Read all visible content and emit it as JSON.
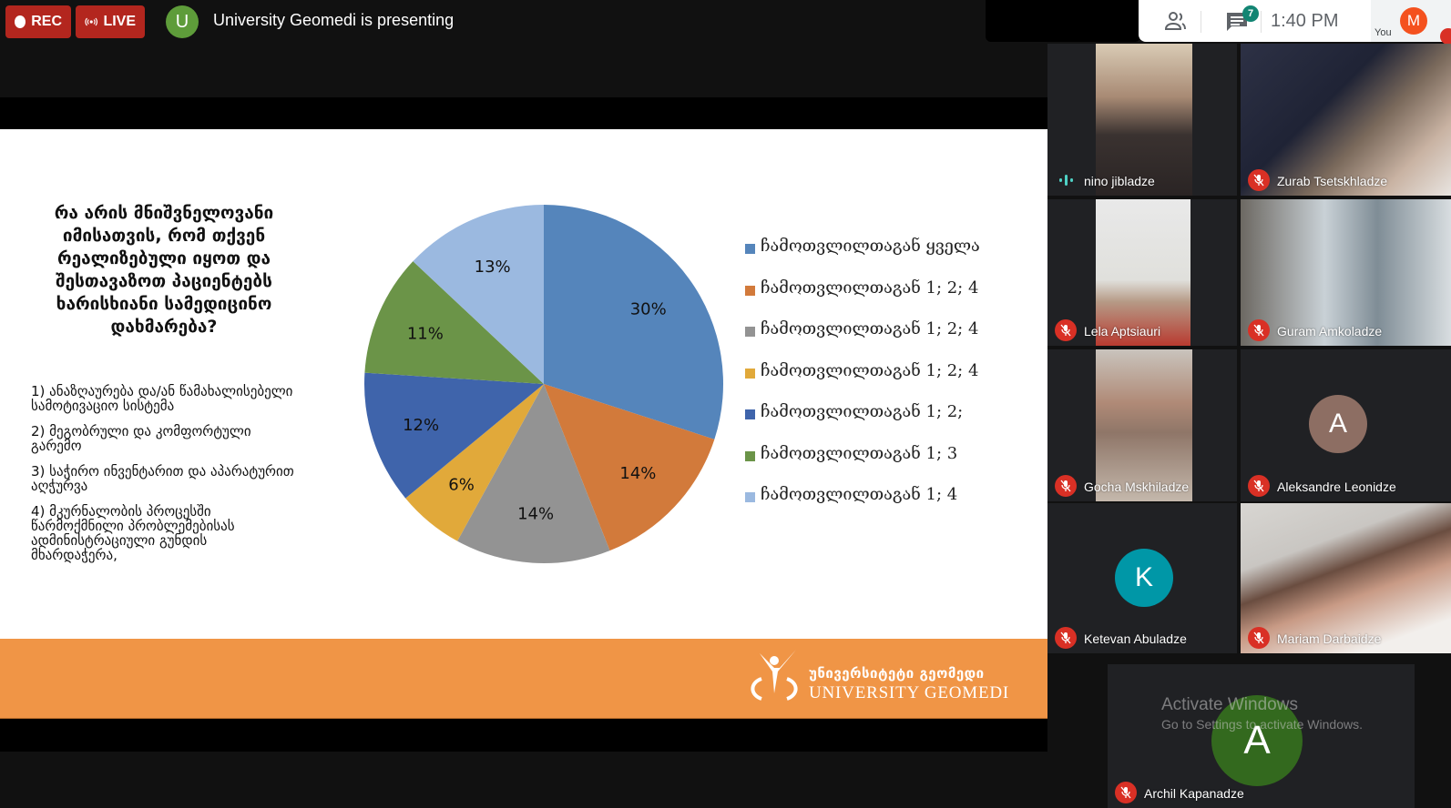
{
  "meeting": {
    "rec_label": "REC",
    "live_label": "LIVE",
    "presenter_initial": "U",
    "presenter_text": "University Geomedi is presenting",
    "chat_count": "7",
    "time": "1:40 PM",
    "you_label": "You",
    "you_initial": "M"
  },
  "slide": {
    "question": "რა არის მნიშვნელოვანი იმისათვის, რომ თქვენ რეალიზებული იყოთ და შესთავაზოთ პაციენტებს ხარისხიანი სამედიცინო დახმარება?",
    "options": [
      "1) ანაზღაურება და/ან წამახალისებელი სამოტივაციო სისტემა",
      "2) მეგობრული და კომფორტული გარემო",
      "3) საჭირო ინვენტარით და აპარატურით აღჭურვა",
      "4) მკურნალობის პროცესში წარმოქმნილი პრობლემებისას ადმინისტრაციული გუნდის მხარდაჭერა,"
    ],
    "logo_ka": "უნივერსიტეტი გეომედი",
    "logo_en": "UNIVERSITY GEOMEDI"
  },
  "chart_data": {
    "type": "pie",
    "title": "",
    "categories": [
      "ჩამოთვლილთაგან ყველა",
      "ჩამოთვლილთაგან 1; 2; 4",
      "ჩამოთვლილთაგან 1; 2; 4",
      "ჩამოთვლილთაგან 1; 2; 4",
      "ჩამოთვლილთაგან 1; 2;",
      "ჩამოთვლილთაგან 1; 3",
      "ჩამოთვლილთაგან 1; 4"
    ],
    "values": [
      30,
      14,
      14,
      6,
      12,
      11,
      13
    ],
    "labels": [
      "30%",
      "14%",
      "14%",
      "6%",
      "12%",
      "11%",
      "13%"
    ],
    "colors": [
      "#5585bb",
      "#d27a3b",
      "#939393",
      "#e1a93a",
      "#3f64ab",
      "#6b9448",
      "#9bb9e0"
    ],
    "start_angle": "12 o'clock, clockwise",
    "legend_position": "right"
  },
  "participants": [
    {
      "name": "nino jibladze",
      "status": "speaking",
      "type": "video"
    },
    {
      "name": "Zurab Tsetskhladze",
      "status": "muted",
      "type": "video"
    },
    {
      "name": "Lela Aptsiauri",
      "status": "muted",
      "type": "video"
    },
    {
      "name": "Guram Amkoladze",
      "status": "muted",
      "type": "video"
    },
    {
      "name": "Gocha Mskhiladze",
      "status": "muted",
      "type": "video"
    },
    {
      "name": "Aleksandre Leonidze",
      "status": "muted",
      "type": "avatar",
      "initial": "A",
      "color": "#8d6e63"
    },
    {
      "name": "Ketevan Abuladze",
      "status": "muted",
      "type": "avatar",
      "initial": "K",
      "color": "#0097a7"
    },
    {
      "name": "Mariam Darbaidze",
      "status": "muted",
      "type": "video"
    },
    {
      "name": "Archil Kapanadze",
      "status": "muted",
      "type": "avatar",
      "initial": "A",
      "color": "#33691e"
    }
  ],
  "watermark": {
    "title": "Activate Windows",
    "subtitle": "Go to Settings to activate Windows."
  }
}
